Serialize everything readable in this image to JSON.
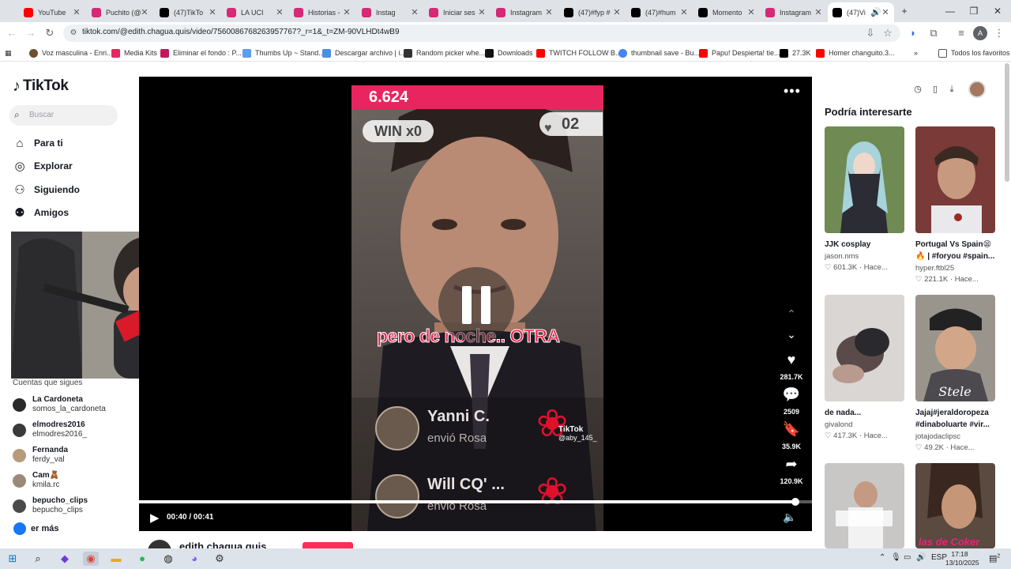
{
  "browser": {
    "tabs": [
      {
        "label": "YouTube",
        "color": "#ff0000"
      },
      {
        "label": "Puchito (@",
        "color": "#d62976"
      },
      {
        "label": "(47)TikTo",
        "color": "#000000"
      },
      {
        "label": "LA UCI",
        "color": "#d62976"
      },
      {
        "label": "Historias -",
        "color": "#d62976"
      },
      {
        "label": "Instag",
        "color": "#d62976"
      },
      {
        "label": "Iniciar ses",
        "color": "#d62976"
      },
      {
        "label": "Instagram",
        "color": "#d62976"
      },
      {
        "label": "(47)#fyp #",
        "color": "#000000"
      },
      {
        "label": "(47)#hum",
        "color": "#000000"
      },
      {
        "label": "Momento",
        "color": "#000000"
      },
      {
        "label": "Instagram",
        "color": "#d62976"
      },
      {
        "label": "(47)Vi",
        "color": "#000000"
      }
    ],
    "active_tab_index": 12,
    "url": "tiktok.com/@edith.chagua.quis/video/7560086768263957767?_r=1&_t=ZM-90VLHDt4wB9",
    "bookmarks": [
      "Voz masculina - Enri...",
      "Media Kits",
      "Eliminar el fondo : P...",
      "Thumbs Up ~ Stand...",
      "Descargar archivo | i...",
      "Random picker whe...",
      "Downloads",
      "TWITCH FOLLOW B...",
      "thumbnail save - Bu...",
      "Papu! Despierta! tie...",
      "27.3K",
      "Homer changuito.3..."
    ],
    "all_bookmarks": "Todos los favoritos"
  },
  "tiktok": {
    "logo": "TikTok",
    "search_placeholder": "Buscar",
    "nav": [
      "Para ti",
      "Explorar",
      "Siguiendo",
      "Amigos"
    ],
    "following_title": "Cuentas que sigues",
    "following": [
      {
        "name": "La Cardoneta",
        "handle": "somos_la_cardoneta"
      },
      {
        "name": "elmodres2016",
        "handle": "elmodres2016_"
      },
      {
        "name": "Fernanda",
        "handle": "ferdy_val"
      },
      {
        "name": "Cam🧸",
        "handle": "kmila.rc"
      },
      {
        "name": "bepucho_clips",
        "handle": "bepucho_clips"
      }
    ],
    "see_more": "er más"
  },
  "video": {
    "score": "6.624",
    "win": "WIN x0",
    "counter": "02",
    "caption": "pero de noche.. OTRA",
    "gifts": [
      {
        "name": "Yanni C.",
        "sub": "envió  Rosa"
      },
      {
        "name": "Will CQ' ...",
        "sub": "envió  Rosa"
      }
    ],
    "watermark": "TikTok",
    "watermark_user": "@aby_145_",
    "likes": "281.7K",
    "comments": "2509",
    "saves": "35.9K",
    "shares": "120.9K",
    "time": "00:40 / 00:41",
    "progress": 0.975,
    "author": "edith.chagua.quis"
  },
  "recommendations": {
    "title": "Podría interesarte",
    "cards": [
      {
        "title": "JJK cosplay",
        "author": "jason.nms",
        "meta": "♡ 601.3K · Hace..."
      },
      {
        "title": "Portugal Vs Spain😫🔥 | #foryou #spain...",
        "author": "hyper.ftbl25",
        "meta": "♡ 221.1K · Hace..."
      },
      {
        "title": "de nada...",
        "author": "givalond",
        "meta": "♡ 417.3K · Hace..."
      },
      {
        "title": "Jajaj#jeraldoropeza #dinaboluarte #vir...",
        "author": "jotajodaclipsc",
        "meta": "♡ 49.2K · Hace..."
      },
      {
        "title": "",
        "author": "",
        "meta": ""
      },
      {
        "title": "",
        "author": "",
        "meta": ""
      }
    ],
    "thumb5_caption": "las de Coker"
  },
  "taskbar": {
    "lang": "ESP",
    "time": "17:18",
    "date": "13/10/2025",
    "notifications": "2"
  }
}
